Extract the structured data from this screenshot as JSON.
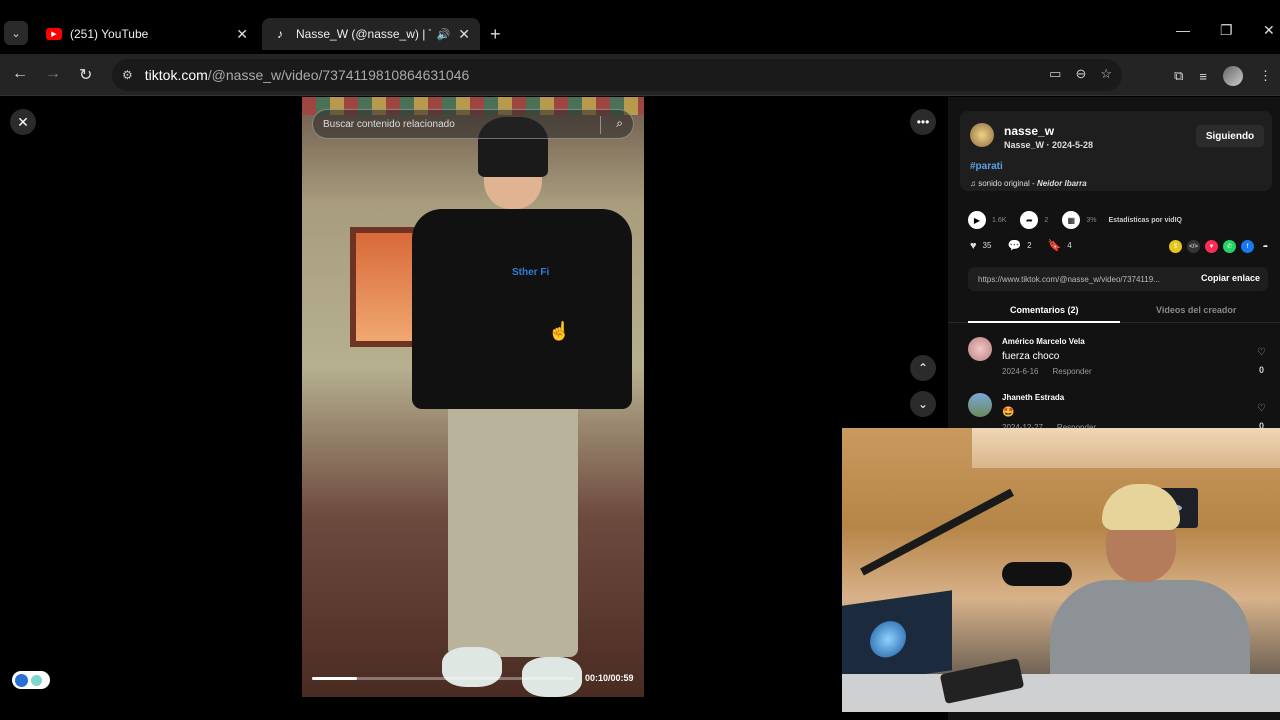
{
  "tabs": [
    {
      "title": "(251) YouTube",
      "favicon": "youtube-icon",
      "active": false
    },
    {
      "title": "Nasse_W (@nasse_w) | TikTo",
      "favicon": "tiktok-icon",
      "active": true,
      "audio": true
    }
  ],
  "address": {
    "host": "tiktok.com",
    "path": "/@nasse_w/video/7374119810864631046"
  },
  "video": {
    "search_placeholder": "Buscar contenido relacionado",
    "time": "00:10/00:59",
    "progress_fraction": 0.17,
    "shirt_text": "Sther Fi"
  },
  "creator": {
    "username": "nasse_w",
    "display_date": "Nasse_W · 2024-5-28",
    "follow_label": "Siguiendo",
    "hashtag": "#parati",
    "sound_prefix": "sonido original - ",
    "sound_artist": "Neidor Ibarra"
  },
  "stats": {
    "plays": "1.6K",
    "shares_small": "2",
    "percent": "3%",
    "stats_label": "Estadísticas por vidIQ"
  },
  "actions": {
    "likes": "35",
    "comments": "2",
    "saves": "4"
  },
  "link": {
    "url": "https://www.tiktok.com/@nasse_w/video/7374119...",
    "copy_label": "Copiar enlace"
  },
  "panel_tabs": {
    "comments": "Comentarios (2)",
    "creator_videos": "Videos del creador"
  },
  "comments": [
    {
      "name": "Américo Marcelo Vela",
      "text": "fuerza choco",
      "date": "2024-6-16",
      "reply": "Responder",
      "likes": "0"
    },
    {
      "name": "Jhaneth Estrada",
      "text": "🤩",
      "date": "2024-12-27",
      "reply": "Responder",
      "likes": "0"
    }
  ],
  "colors": {
    "accent_blue": "#5aa0e6",
    "tiktok_red": "#fe2c55",
    "background": "#000000"
  }
}
